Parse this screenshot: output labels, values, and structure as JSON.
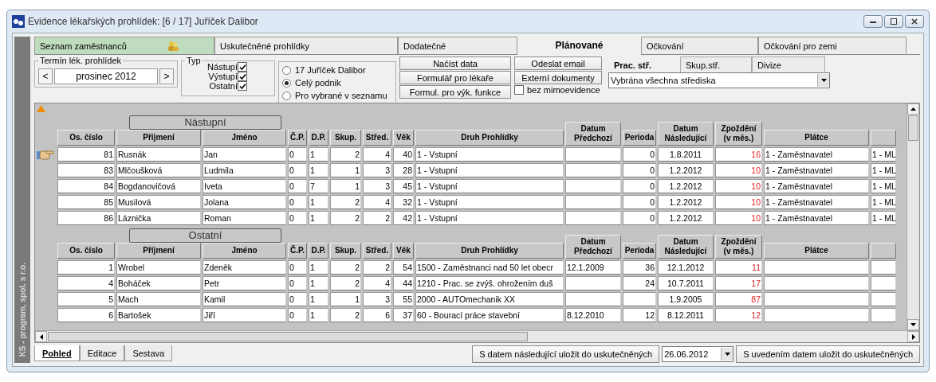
{
  "window": {
    "title": "Evidence lékařských prohlídek: [6 / 17] Juříček Dalibor"
  },
  "sidebar": {
    "text": "KS - program, spol. s r.o."
  },
  "tabs": [
    {
      "label": "Seznam zaměstnanců",
      "highlighted": true,
      "selected": false
    },
    {
      "label": "Uskutečněné prohlídky",
      "highlighted": false,
      "selected": false
    },
    {
      "label": "Dodatečné",
      "highlighted": false,
      "selected": false
    },
    {
      "label": "Plánované",
      "highlighted": false,
      "selected": true
    },
    {
      "label": "Očkování",
      "highlighted": false,
      "selected": false
    },
    {
      "label": "Očkování pro zemi",
      "highlighted": false,
      "selected": false
    }
  ],
  "period": {
    "legend": "Termín lék. prohlídek",
    "prev": "<",
    "value": "prosinec 2012",
    "next": ">"
  },
  "type_filter": {
    "legend": "Typ",
    "options": [
      {
        "label": "Nástupí",
        "checked": true
      },
      {
        "label": "Výstupí",
        "checked": true
      },
      {
        "label": "Ostatní",
        "checked": true
      }
    ]
  },
  "scope": [
    {
      "label": "17 Juříček Dalibor",
      "selected": false
    },
    {
      "label": "Celý podnik",
      "selected": true
    },
    {
      "label": "Pro vybrané v seznamu",
      "selected": false
    }
  ],
  "buttons_left": [
    "Načíst data",
    "Formulář pro lékaře",
    "Formul. pro výk. funkce"
  ],
  "buttons_right": [
    "Odeslat email",
    "Externí dokumenty"
  ],
  "outside_register": {
    "label": "bez mimoevidence",
    "checked": false
  },
  "center_tabs": [
    {
      "label": "Prac. stř.",
      "selected": true
    },
    {
      "label": "Skup.stř.",
      "selected": false
    },
    {
      "label": "Divize",
      "selected": false
    }
  ],
  "center_select": {
    "value": "Vybrána všechna střediska"
  },
  "sections": [
    {
      "title": "Nástupní",
      "columns": [
        {
          "label": "Os. číslo",
          "kind": "num"
        },
        {
          "label": "Příjmení",
          "kind": "text"
        },
        {
          "label": "Jméno",
          "kind": "text"
        },
        {
          "label": "Č.P.",
          "kind": "text"
        },
        {
          "label": "D.P.",
          "kind": "text"
        },
        {
          "label": "Skup.",
          "kind": "num"
        },
        {
          "label": "Střed.",
          "kind": "num"
        },
        {
          "label": "Věk",
          "kind": "num"
        },
        {
          "label": "Druh Prohlídky",
          "kind": "text"
        },
        {
          "label": "Datum Předchozí",
          "kind": "text"
        },
        {
          "label": "Perioda",
          "kind": "num"
        },
        {
          "label": "Datum Následující",
          "kind": "date"
        },
        {
          "label": "Zpoždění (v měs.)",
          "kind": "delay"
        },
        {
          "label": "Plátce",
          "kind": "text"
        },
        {
          "kind": "text"
        }
      ],
      "rows": [
        {
          "current": true,
          "cells": [
            "81",
            "Rusnák",
            "Jan",
            "0",
            "1",
            "2",
            "4",
            "40",
            "1 - Vstupní",
            null,
            "0",
            "1.8.2011",
            "16",
            "1 - Zaměstnavatel",
            "1 - ML"
          ]
        },
        {
          "current": false,
          "cells": [
            "83",
            "Mlčoušková",
            "Ludmila",
            "0",
            "1",
            "1",
            "3",
            "28",
            "1 - Vstupní",
            null,
            "0",
            "1.2.2012",
            "10",
            "1 - Zaměstnavatel",
            "1 - ML"
          ]
        },
        {
          "current": false,
          "cells": [
            "84",
            "Bogdanovičová",
            "Iveta",
            "0",
            "7",
            "1",
            "3",
            "45",
            "1 - Vstupní",
            null,
            "0",
            "1.2.2012",
            "10",
            "1 - Zaměstnavatel",
            "1 - ML"
          ]
        },
        {
          "current": false,
          "cells": [
            "85",
            "Musilová",
            "Jolana",
            "0",
            "1",
            "2",
            "4",
            "32",
            "1 - Vstupní",
            null,
            "0",
            "1.2.2012",
            "10",
            "1 - Zaměstnavatel",
            "1 - ML"
          ]
        },
        {
          "current": false,
          "cells": [
            "86",
            "Láznička",
            "Roman",
            "0",
            "1",
            "2",
            "2",
            "42",
            "1 - Vstupní",
            null,
            "0",
            "1.2.2012",
            "10",
            "1 - Zaměstnavatel",
            "1 - ML"
          ]
        }
      ]
    },
    {
      "title": "Ostatní",
      "columns": [
        {
          "label": "Os. číslo",
          "kind": "num"
        },
        {
          "label": "Příjmení",
          "kind": "text"
        },
        {
          "label": "Jméno",
          "kind": "text"
        },
        {
          "label": "Č.P.",
          "kind": "text"
        },
        {
          "label": "D.P.",
          "kind": "text"
        },
        {
          "label": "Skup.",
          "kind": "num"
        },
        {
          "label": "Střed.",
          "kind": "num"
        },
        {
          "label": "Věk",
          "kind": "num"
        },
        {
          "label": "Druh Prohlídky",
          "kind": "text"
        },
        {
          "label": "Datum Předchozí",
          "kind": "text"
        },
        {
          "label": "Perioda",
          "kind": "num"
        },
        {
          "label": "Datum Následující",
          "kind": "date"
        },
        {
          "label": "Zpoždění (v měs.)",
          "kind": "delay"
        },
        {
          "label": "Plátce",
          "kind": "text"
        },
        {
          "kind": "text"
        }
      ],
      "rows": [
        {
          "current": false,
          "cells": [
            "1",
            "Wrobel",
            "Zdeněk",
            "0",
            "1",
            "2",
            "2",
            "54",
            "1500 - Zaměstnanci nad 50 let obecr",
            "12.1.2009",
            "36",
            "12.1.2012",
            "11",
            null,
            null
          ]
        },
        {
          "current": false,
          "cells": [
            "4",
            "Boháček",
            "Petr",
            "0",
            "1",
            "2",
            "4",
            "44",
            "1210 - Prac. se zvýš. ohrožením duš",
            null,
            "24",
            "10.7.2011",
            "17",
            null,
            null
          ]
        },
        {
          "current": false,
          "cells": [
            "5",
            "Mach",
            "Kamil",
            "0",
            "1",
            "1",
            "3",
            "55",
            "2000 - AUTOmechanik XX",
            null,
            null,
            "1.9.2005",
            "87",
            null,
            null
          ]
        },
        {
          "current": false,
          "cells": [
            "6",
            "Bartošek",
            "Jiří",
            "0",
            "1",
            "2",
            "6",
            "37",
            "60 - Bourací práce stavební",
            "8.12.2010",
            "12",
            "8.12.2011",
            "12",
            null,
            null
          ]
        }
      ]
    }
  ],
  "bottom_tabs": [
    {
      "label": "Pohled",
      "selected": true
    },
    {
      "label": "Editace",
      "selected": false
    },
    {
      "label": "Sestava",
      "selected": false
    }
  ],
  "save_next_button": "S datem následující uložit do uskutečněných",
  "date_select": {
    "value": "26.06.2012"
  },
  "save_date_button": "S uvedením datem uložit do uskutečněných"
}
